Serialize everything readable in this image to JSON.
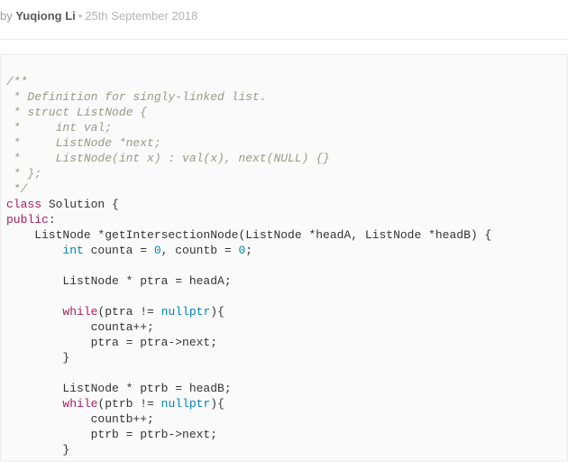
{
  "byline": {
    "by": "by ",
    "author": "Yuqiong Li",
    "separator": "•",
    "date": "25th September 2018"
  },
  "code": {
    "c1": "/**",
    "c2": " * Definition for singly-linked list.",
    "c3": " * struct ListNode {",
    "c4": " *     int val;",
    "c5": " *     ListNode *next;",
    "c6": " *     ListNode(int x) : val(x), next(NULL) {}",
    "c7": " * };",
    "c8": " */",
    "kw_class": "class",
    "class_name": " Solution {",
    "kw_public": "public",
    "colon": ":",
    "fn_sig_pre": "    ListNode *getIntersectionNode(ListNode *headA, ListNode *headB) {",
    "int_kw": "int",
    "counta_pre": "        ",
    "counta_mid1": " counta = ",
    "zero1": "0",
    "counta_mid2": ", countb = ",
    "zero2": "0",
    "counta_end": ";",
    "blank": "",
    "ptra_line": "        ListNode * ptra = headA;",
    "while_kw": "while",
    "while1_pre": "        ",
    "while1_cond_a": "(ptra != ",
    "nullptr_kw": "nullptr",
    "while1_cond_b": "){",
    "while1_body1": "            counta++;",
    "while1_body2": "            ptra = ptra->next;",
    "while1_close": "        }",
    "ptrb_line": "        ListNode * ptrb = headB;",
    "while2_pre": "        ",
    "while2_cond_a": "(ptrb != ",
    "while2_cond_b": "){",
    "while2_body1": "            countb++;",
    "while2_body2": "            ptrb = ptrb->next;",
    "while2_close": "        }"
  }
}
